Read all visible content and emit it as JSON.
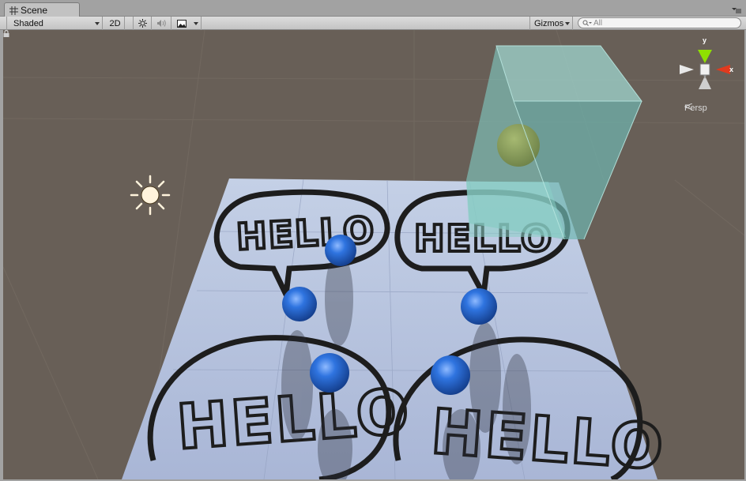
{
  "window": {
    "tab_title": "Scene",
    "tab_icon": "grid-icon",
    "menu_icon": "tab-menu-icon"
  },
  "toolbar": {
    "draw_mode": "Shaded",
    "toggle_2d": "2D",
    "lighting_icon": "sun-icon",
    "audio_icon": "speaker-icon",
    "effects_icon": "image-icon",
    "gizmos_label": "Gizmos",
    "search_placeholder": "All",
    "search_icon": "search-icon"
  },
  "scene": {
    "floor_texture_text": "HELLO",
    "light_icon": "directional-light-icon",
    "sphere_color": "#2a6bd9",
    "cube_color": "#7fc4c0",
    "green_sphere_color": "#8a9a4f",
    "background_color": "#685f57"
  },
  "gizmo": {
    "y_label": "y",
    "x_label": "x",
    "projection": "Persp",
    "lock_icon": "lock-icon"
  }
}
